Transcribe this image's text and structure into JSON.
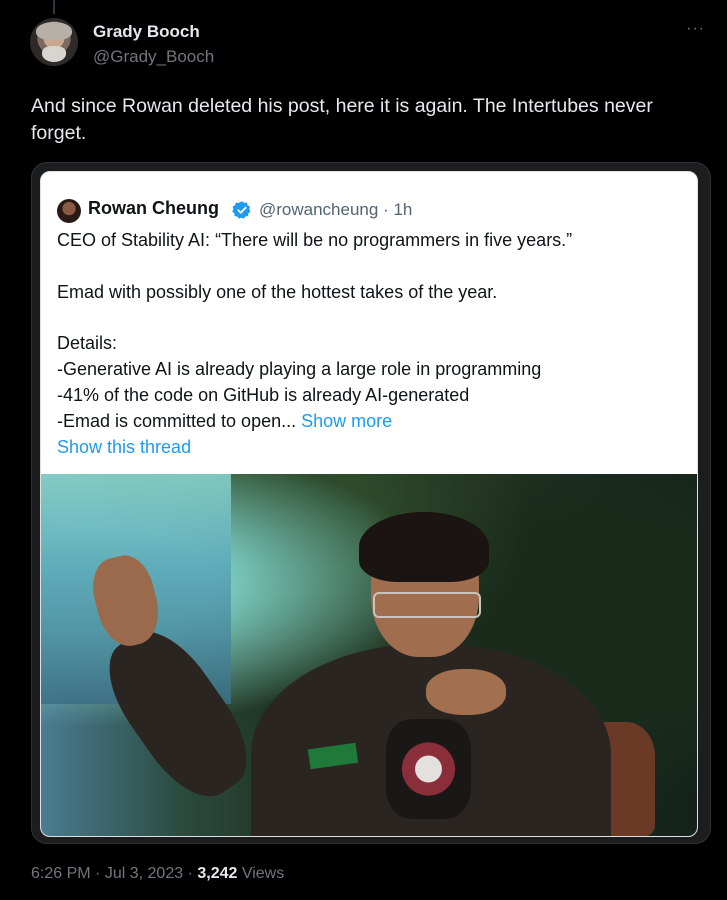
{
  "tweet": {
    "author": {
      "name": "Grady Booch",
      "handle": "@Grady_Booch"
    },
    "more_icon": "more-horizontal-icon",
    "text": "And since Rowan deleted his post, here it is again. The Intertubes never forget.",
    "meta": {
      "time": "6:26 PM",
      "separator": "·",
      "date": "Jul 3, 2023",
      "views_count": "3,242",
      "views_label": "Views"
    }
  },
  "quoted_tweet": {
    "author": {
      "name": "Rowan Cheung",
      "handle_time": "@rowancheung · 1h",
      "verified_icon": "verified-badge-icon"
    },
    "lines": [
      "CEO of Stability AI: “There will be no programmers in five years.”",
      "",
      "Emad with possibly one of the hottest takes of the year.",
      "",
      "Details:",
      "-Generative AI is already playing a large role in programming",
      "-41% of the code on GitHub is already AI-generated"
    ],
    "last_line": "-Emad is committed to open...",
    "show_more": "Show more",
    "show_thread": "Show this thread"
  },
  "colors": {
    "background": "#000000",
    "text_primary": "#e7e9ea",
    "text_secondary": "#71767b",
    "link_blue": "#1d9bf0",
    "verified_blue": "#1d9bf0"
  }
}
